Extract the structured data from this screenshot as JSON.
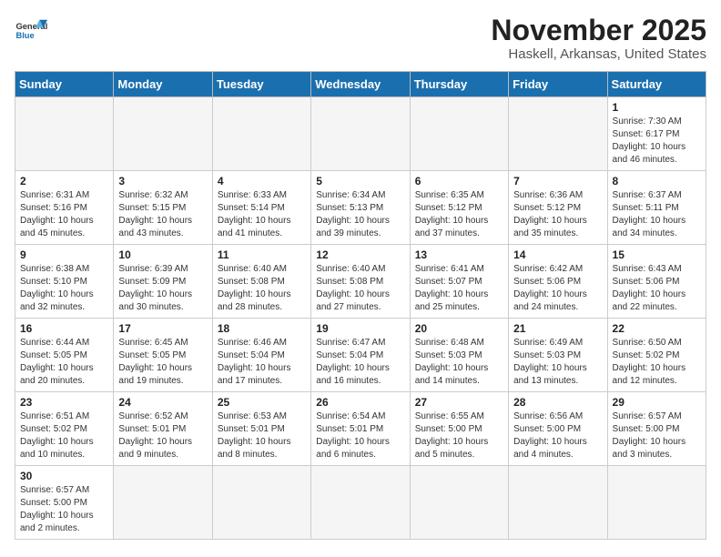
{
  "header": {
    "logo_line1": "General",
    "logo_line2": "Blue",
    "month_title": "November 2025",
    "location": "Haskell, Arkansas, United States"
  },
  "days_of_week": [
    "Sunday",
    "Monday",
    "Tuesday",
    "Wednesday",
    "Thursday",
    "Friday",
    "Saturday"
  ],
  "weeks": [
    [
      {
        "day": "",
        "info": ""
      },
      {
        "day": "",
        "info": ""
      },
      {
        "day": "",
        "info": ""
      },
      {
        "day": "",
        "info": ""
      },
      {
        "day": "",
        "info": ""
      },
      {
        "day": "",
        "info": ""
      },
      {
        "day": "1",
        "info": "Sunrise: 7:30 AM\nSunset: 6:17 PM\nDaylight: 10 hours\nand 46 minutes."
      }
    ],
    [
      {
        "day": "2",
        "info": "Sunrise: 6:31 AM\nSunset: 5:16 PM\nDaylight: 10 hours\nand 45 minutes."
      },
      {
        "day": "3",
        "info": "Sunrise: 6:32 AM\nSunset: 5:15 PM\nDaylight: 10 hours\nand 43 minutes."
      },
      {
        "day": "4",
        "info": "Sunrise: 6:33 AM\nSunset: 5:14 PM\nDaylight: 10 hours\nand 41 minutes."
      },
      {
        "day": "5",
        "info": "Sunrise: 6:34 AM\nSunset: 5:13 PM\nDaylight: 10 hours\nand 39 minutes."
      },
      {
        "day": "6",
        "info": "Sunrise: 6:35 AM\nSunset: 5:12 PM\nDaylight: 10 hours\nand 37 minutes."
      },
      {
        "day": "7",
        "info": "Sunrise: 6:36 AM\nSunset: 5:12 PM\nDaylight: 10 hours\nand 35 minutes."
      },
      {
        "day": "8",
        "info": "Sunrise: 6:37 AM\nSunset: 5:11 PM\nDaylight: 10 hours\nand 34 minutes."
      }
    ],
    [
      {
        "day": "9",
        "info": "Sunrise: 6:38 AM\nSunset: 5:10 PM\nDaylight: 10 hours\nand 32 minutes."
      },
      {
        "day": "10",
        "info": "Sunrise: 6:39 AM\nSunset: 5:09 PM\nDaylight: 10 hours\nand 30 minutes."
      },
      {
        "day": "11",
        "info": "Sunrise: 6:40 AM\nSunset: 5:08 PM\nDaylight: 10 hours\nand 28 minutes."
      },
      {
        "day": "12",
        "info": "Sunrise: 6:40 AM\nSunset: 5:08 PM\nDaylight: 10 hours\nand 27 minutes."
      },
      {
        "day": "13",
        "info": "Sunrise: 6:41 AM\nSunset: 5:07 PM\nDaylight: 10 hours\nand 25 minutes."
      },
      {
        "day": "14",
        "info": "Sunrise: 6:42 AM\nSunset: 5:06 PM\nDaylight: 10 hours\nand 24 minutes."
      },
      {
        "day": "15",
        "info": "Sunrise: 6:43 AM\nSunset: 5:06 PM\nDaylight: 10 hours\nand 22 minutes."
      }
    ],
    [
      {
        "day": "16",
        "info": "Sunrise: 6:44 AM\nSunset: 5:05 PM\nDaylight: 10 hours\nand 20 minutes."
      },
      {
        "day": "17",
        "info": "Sunrise: 6:45 AM\nSunset: 5:05 PM\nDaylight: 10 hours\nand 19 minutes."
      },
      {
        "day": "18",
        "info": "Sunrise: 6:46 AM\nSunset: 5:04 PM\nDaylight: 10 hours\nand 17 minutes."
      },
      {
        "day": "19",
        "info": "Sunrise: 6:47 AM\nSunset: 5:04 PM\nDaylight: 10 hours\nand 16 minutes."
      },
      {
        "day": "20",
        "info": "Sunrise: 6:48 AM\nSunset: 5:03 PM\nDaylight: 10 hours\nand 14 minutes."
      },
      {
        "day": "21",
        "info": "Sunrise: 6:49 AM\nSunset: 5:03 PM\nDaylight: 10 hours\nand 13 minutes."
      },
      {
        "day": "22",
        "info": "Sunrise: 6:50 AM\nSunset: 5:02 PM\nDaylight: 10 hours\nand 12 minutes."
      }
    ],
    [
      {
        "day": "23",
        "info": "Sunrise: 6:51 AM\nSunset: 5:02 PM\nDaylight: 10 hours\nand 10 minutes."
      },
      {
        "day": "24",
        "info": "Sunrise: 6:52 AM\nSunset: 5:01 PM\nDaylight: 10 hours\nand 9 minutes."
      },
      {
        "day": "25",
        "info": "Sunrise: 6:53 AM\nSunset: 5:01 PM\nDaylight: 10 hours\nand 8 minutes."
      },
      {
        "day": "26",
        "info": "Sunrise: 6:54 AM\nSunset: 5:01 PM\nDaylight: 10 hours\nand 6 minutes."
      },
      {
        "day": "27",
        "info": "Sunrise: 6:55 AM\nSunset: 5:00 PM\nDaylight: 10 hours\nand 5 minutes."
      },
      {
        "day": "28",
        "info": "Sunrise: 6:56 AM\nSunset: 5:00 PM\nDaylight: 10 hours\nand 4 minutes."
      },
      {
        "day": "29",
        "info": "Sunrise: 6:57 AM\nSunset: 5:00 PM\nDaylight: 10 hours\nand 3 minutes."
      }
    ],
    [
      {
        "day": "30",
        "info": "Sunrise: 6:57 AM\nSunset: 5:00 PM\nDaylight: 10 hours\nand 2 minutes."
      },
      {
        "day": "",
        "info": ""
      },
      {
        "day": "",
        "info": ""
      },
      {
        "day": "",
        "info": ""
      },
      {
        "day": "",
        "info": ""
      },
      {
        "day": "",
        "info": ""
      },
      {
        "day": "",
        "info": ""
      }
    ]
  ]
}
